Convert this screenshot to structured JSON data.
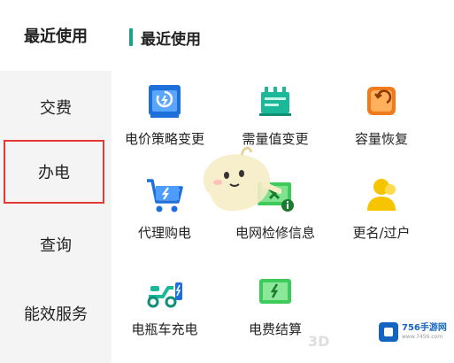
{
  "sidebar": {
    "items": [
      {
        "label": "最近使用"
      },
      {
        "label": "交费"
      },
      {
        "label": "办电"
      },
      {
        "label": "查询"
      },
      {
        "label": "能效服务"
      }
    ]
  },
  "main": {
    "section_title": "最近使用",
    "tiles": [
      {
        "label": "电价策略变更",
        "icon": "price-policy-icon"
      },
      {
        "label": "需量值变更",
        "icon": "demand-change-icon"
      },
      {
        "label": "容量恢复",
        "icon": "capacity-restore-icon"
      },
      {
        "label": "代理购电",
        "icon": "cart-bolt-icon"
      },
      {
        "label": "电网检修信息",
        "icon": "grid-maintenance-icon"
      },
      {
        "label": "更名/过户",
        "icon": "user-transfer-icon"
      },
      {
        "label": "电瓶车充电",
        "icon": "ebike-charge-icon"
      },
      {
        "label": "电费结算",
        "icon": "bill-settlement-icon"
      }
    ]
  },
  "watermark": {
    "name": "756手游网",
    "url": "www.7456.com",
    "faint": "3D"
  },
  "colors": {
    "accent": "#1aa38a",
    "highlight_border": "#e53935",
    "sidebar_bg": "#f4f4f4"
  }
}
